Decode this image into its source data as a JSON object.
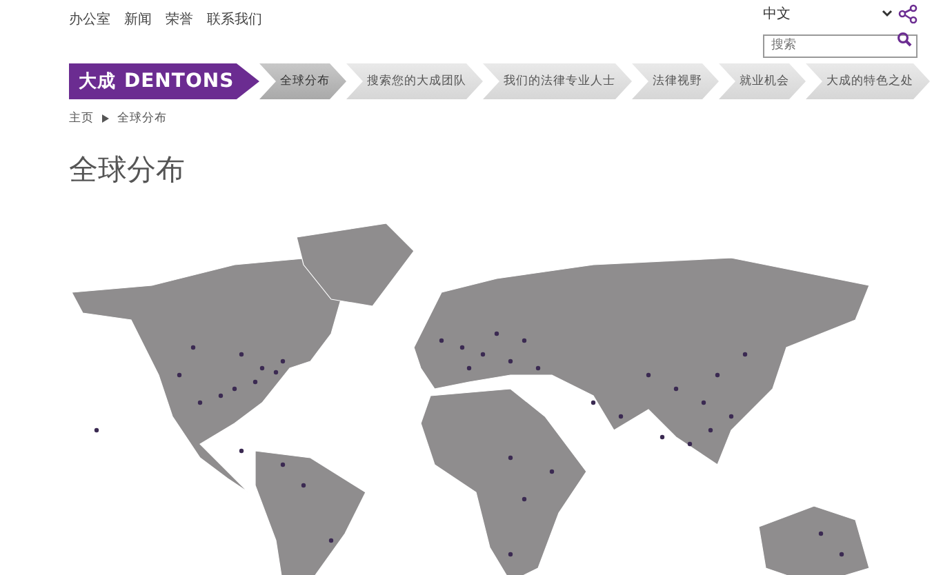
{
  "top_links": [
    "办公室",
    "新闻",
    "荣誉",
    "联系我们"
  ],
  "language": "中文",
  "search": {
    "placeholder": "搜索"
  },
  "logo": {
    "mark": "大成",
    "name": "DENTONS"
  },
  "tabs": [
    {
      "label": "全球分布",
      "selected": true
    },
    {
      "label": "搜索您的大成团队",
      "selected": false
    },
    {
      "label": "我们的法律专业人士",
      "selected": false
    },
    {
      "label": "法律视野",
      "selected": false
    },
    {
      "label": "就业机会",
      "selected": false
    },
    {
      "label": "大成的特色之处",
      "selected": false
    }
  ],
  "breadcrumb": [
    "主页",
    "全球分布"
  ],
  "title": "全球分布"
}
